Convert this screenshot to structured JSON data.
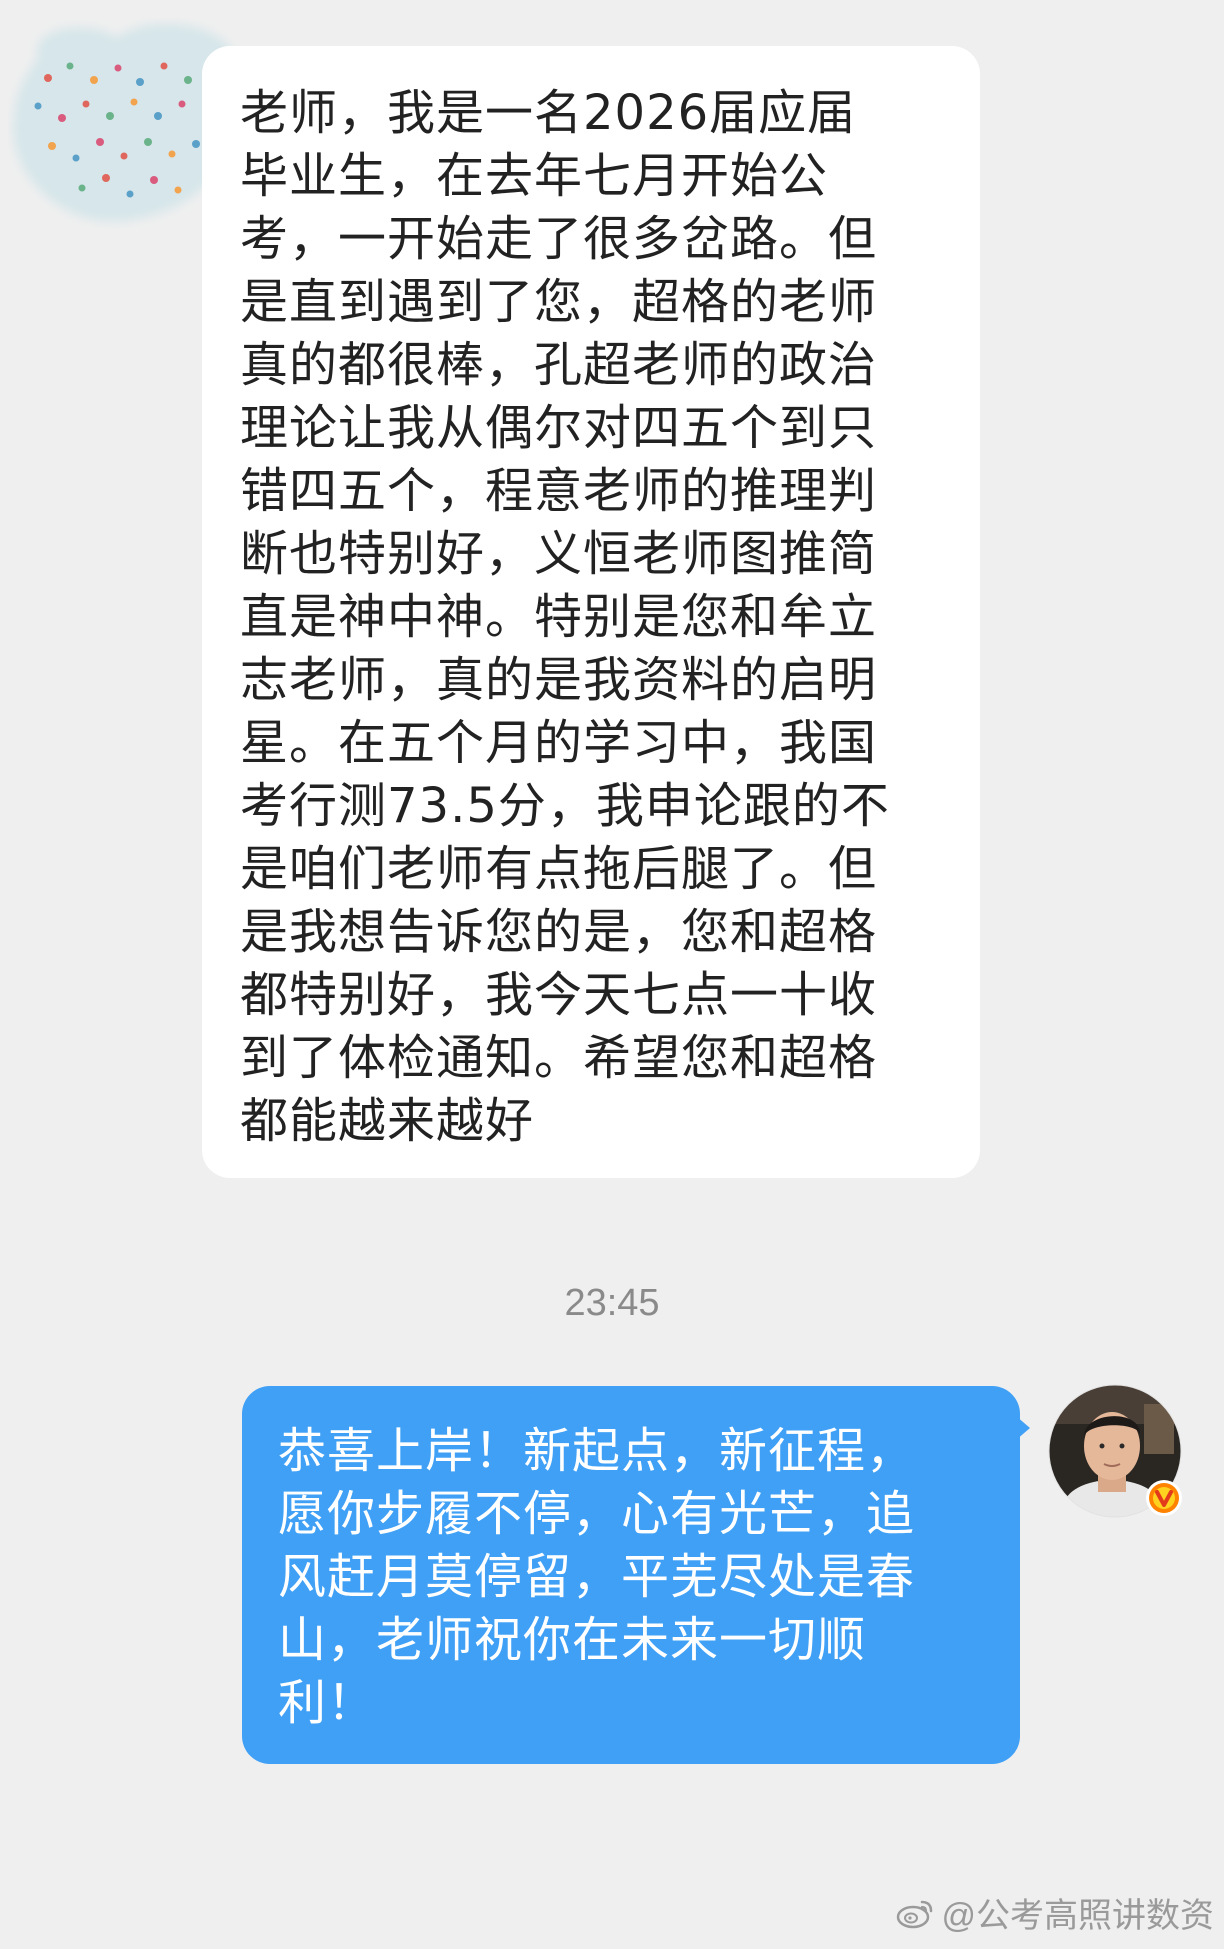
{
  "incoming_message": {
    "lines": [
      "老师，我是一名2026届应届",
      "毕业生，在去年七月开始公",
      "考，一开始走了很多岔路。但",
      "是直到遇到了您，超格的老师",
      "真的都很棒，孔超老师的政治",
      "理论让我从偶尔对四五个到只",
      "错四五个，程意老师的推理判",
      "断也特别好，义恒老师图推简",
      "直是神中神。特别是您和牟立",
      "志老师，真的是我资料的启明",
      "星。在五个月的学习中，我国",
      "考行测73.5分，我申论跟的不",
      "是咱们老师有点拖后腿了。但",
      "是我想告诉您的是，您和超格",
      "都特别好，我今天七点一十收",
      "到了体检通知。希望您和超格",
      "都能越来越好"
    ]
  },
  "timestamp": "23:45",
  "outgoing_message": {
    "lines": [
      "恭喜上岸！新起点，新征程，",
      "愿你步履不停，心有光芒，追",
      "风赶月莫停留，平芜尽处是春",
      "山，老师祝你在未来一切顺",
      "利！"
    ]
  },
  "watermark": {
    "text": "@公考高照讲数资",
    "icon": "weibo-logo-icon"
  },
  "colors": {
    "background": "#efefef",
    "incoming_bubble": "#ffffff",
    "outgoing_bubble": "#3fa0f6",
    "verified_badge": "#ff8200"
  },
  "icons": {
    "sender_avatar": "blurred-polka-dot-avatar",
    "teacher_avatar": "teacher-photo-avatar",
    "verified_badge": "verified-v-badge-icon"
  }
}
